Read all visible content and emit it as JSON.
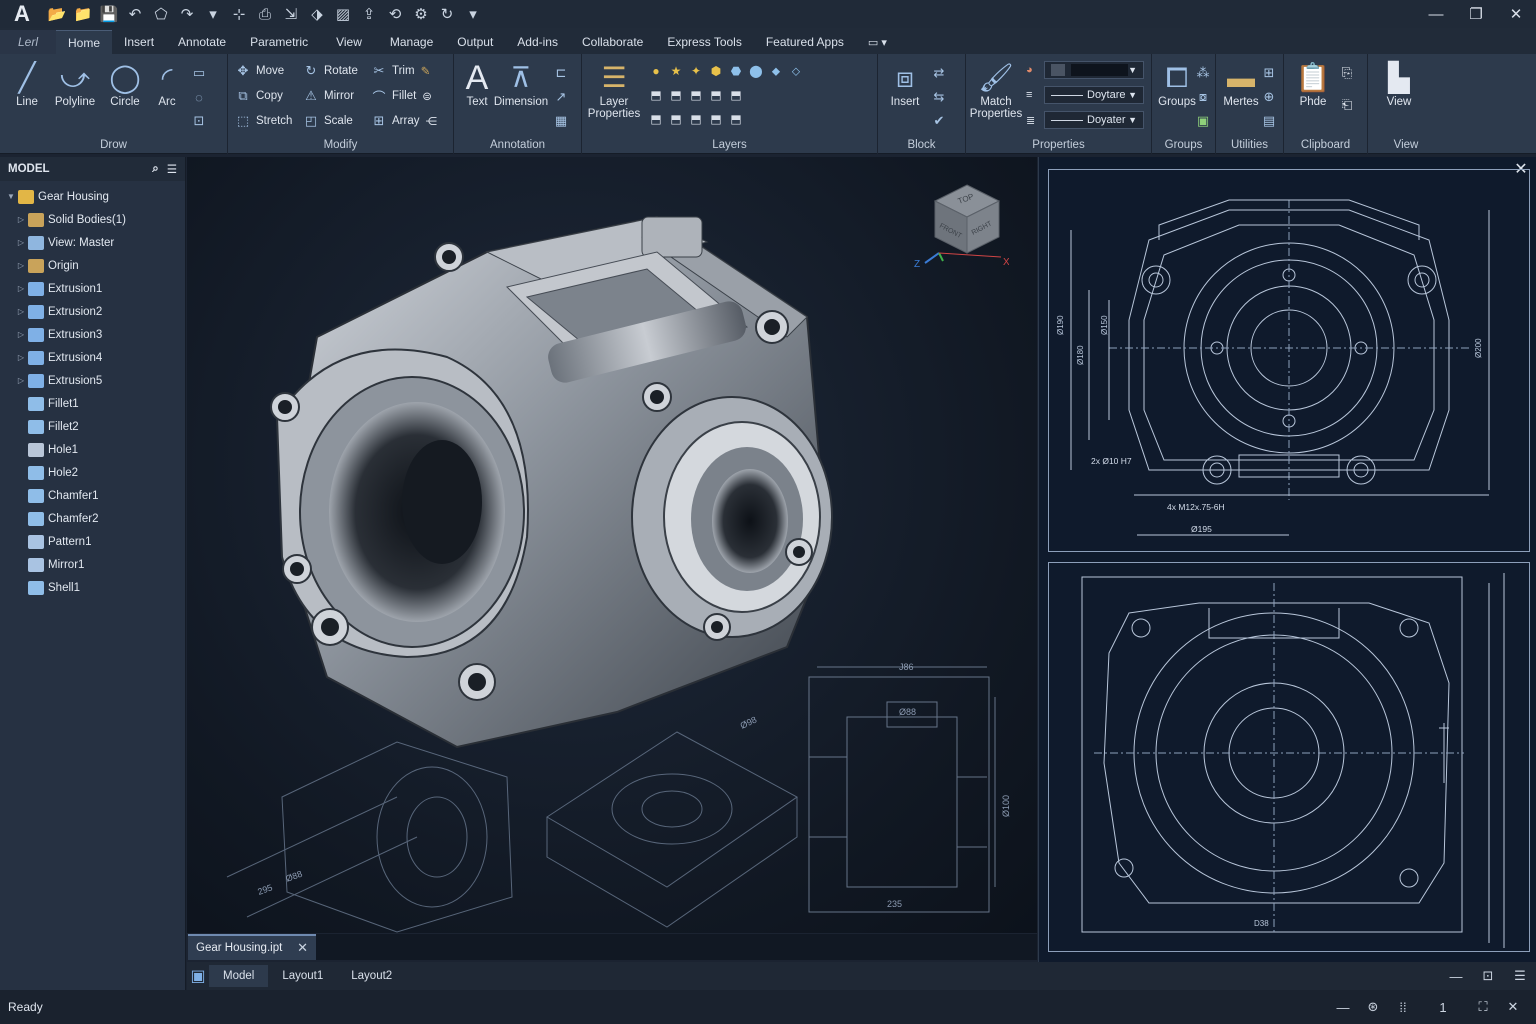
{
  "app": {
    "logo": "A"
  },
  "quick_access": [
    {
      "name": "open-folder-icon",
      "glyph": "📂"
    },
    {
      "name": "open-icon",
      "glyph": "📁"
    },
    {
      "name": "save-icon",
      "glyph": "💾"
    },
    {
      "name": "undo-icon",
      "glyph": "↶"
    },
    {
      "name": "shape-icon",
      "glyph": "⬠"
    },
    {
      "name": "redo-icon",
      "glyph": "↷"
    },
    {
      "name": "dropdown-icon",
      "glyph": "▾"
    },
    {
      "name": "measure-icon",
      "glyph": "⊹"
    },
    {
      "name": "print-icon",
      "glyph": "⎙"
    },
    {
      "name": "export-icon",
      "glyph": "⇲"
    },
    {
      "name": "share-icon",
      "glyph": "⬗"
    },
    {
      "name": "image-icon",
      "glyph": "▨"
    },
    {
      "name": "upload-icon",
      "glyph": "⇪"
    },
    {
      "name": "sync-icon",
      "glyph": "⟲"
    },
    {
      "name": "gear-icon",
      "glyph": "⚙"
    },
    {
      "name": "refresh-icon",
      "glyph": "↻"
    },
    {
      "name": "more-icon",
      "glyph": "▾"
    }
  ],
  "window": {
    "minimize": "—",
    "restore": "❐",
    "close": "✕"
  },
  "tabs": [
    "Home",
    "Insert",
    "Annotate",
    "Parametric",
    "View",
    "Manage",
    "Output",
    "Add-ins",
    "Collaborate",
    "Express Tools",
    "Featured Apps"
  ],
  "file_tab": "Lеrl",
  "ribbon": {
    "draw": {
      "title": "Drow",
      "tools": [
        "Line",
        "Polyline",
        "Circle",
        "Arc"
      ]
    },
    "modify": {
      "title": "Modify",
      "rows": [
        [
          "Move",
          "Rotate",
          "Trim"
        ],
        [
          "Copy",
          "Mirror",
          "Fillet"
        ],
        [
          "Stretch",
          "Scale",
          "Array"
        ]
      ]
    },
    "annotation": {
      "title": "Annotation",
      "text": "Text",
      "dimension": "Dimension"
    },
    "layers": {
      "title": "Layers",
      "layer_properties_1": "Layer",
      "layer_properties_2": "Properties"
    },
    "block": {
      "title": "Block",
      "insert": "Insert"
    },
    "properties": {
      "title": "Properties",
      "match_1": "Match",
      "match_2": "Properties",
      "linetype_1": "Doytare",
      "linetype_2": "Doyater"
    },
    "groups": {
      "title": "Groups",
      "tool": "Groups"
    },
    "utilities": {
      "title": "Utilities",
      "tool": "Mertes"
    },
    "clipboard": {
      "title": "Clipboard",
      "tool": "Phde"
    },
    "view": {
      "title": "View",
      "tool": "View"
    }
  },
  "browser": {
    "title": "MODEL",
    "items": [
      {
        "label": "Gear Housing",
        "icon": "#e2b646",
        "level": 0,
        "exp": "▼"
      },
      {
        "label": "Solid Bodies(1)",
        "icon": "#c9a35a",
        "level": 1,
        "exp": "▷"
      },
      {
        "label": "View: Master",
        "icon": "#8fb6df",
        "level": 1,
        "exp": "▷"
      },
      {
        "label": "Origin",
        "icon": "#c9a35a",
        "level": 1,
        "exp": "▷"
      },
      {
        "label": "Extrusion1",
        "icon": "#7fb0e6",
        "level": 1,
        "exp": "▷"
      },
      {
        "label": "Extrusion2",
        "icon": "#7fb0e6",
        "level": 1,
        "exp": "▷"
      },
      {
        "label": "Extrusion3",
        "icon": "#7fb0e6",
        "level": 1,
        "exp": "▷"
      },
      {
        "label": "Extrusion4",
        "icon": "#7fb0e6",
        "level": 1,
        "exp": "▷"
      },
      {
        "label": "Extrusion5",
        "icon": "#7fb0e6",
        "level": 1,
        "exp": "▷"
      },
      {
        "label": "Fillet1",
        "icon": "#8fbde8",
        "level": 1,
        "exp": ""
      },
      {
        "label": "Fillet2",
        "icon": "#8fbde8",
        "level": 1,
        "exp": ""
      },
      {
        "label": "Hole1",
        "icon": "#b9c6d8",
        "level": 1,
        "exp": ""
      },
      {
        "label": "Hole2",
        "icon": "#8fbde8",
        "level": 1,
        "exp": ""
      },
      {
        "label": "Chamfer1",
        "icon": "#8fbde8",
        "level": 1,
        "exp": ""
      },
      {
        "label": "Chamfer2",
        "icon": "#8fbde8",
        "level": 1,
        "exp": ""
      },
      {
        "label": "Pattern1",
        "icon": "#a9c3e2",
        "level": 1,
        "exp": ""
      },
      {
        "label": "Mirror1",
        "icon": "#a9c3e2",
        "level": 1,
        "exp": ""
      },
      {
        "label": "Shell1",
        "icon": "#8fbde8",
        "level": 1,
        "exp": ""
      }
    ]
  },
  "viewcube": {
    "top": "TOP",
    "front": "FRONT",
    "right": "RIGHT"
  },
  "axis": {
    "z": "Z",
    "x": "X"
  },
  "drawing_labels": {
    "d1": "Ø190",
    "d2": "Ø150",
    "d3": "Ø180",
    "d4": "2x Ø10 H7",
    "d5": "4x M12x.75-6H",
    "d6": "Ø195",
    "d7": "Ø200",
    "s1": "J86",
    "s2": "Ø88",
    "s3": "Ø100",
    "s4": "235",
    "i1": "Ø98",
    "i2": "295",
    "i3": "Ø88",
    "b1": "D38"
  },
  "doc_tab": {
    "label": "Gear Housing.ipt",
    "close": "✕"
  },
  "layout_tabs": [
    "Model",
    "Layout1",
    "Layout2"
  ],
  "status": {
    "text": "Ready",
    "scale": "1"
  }
}
